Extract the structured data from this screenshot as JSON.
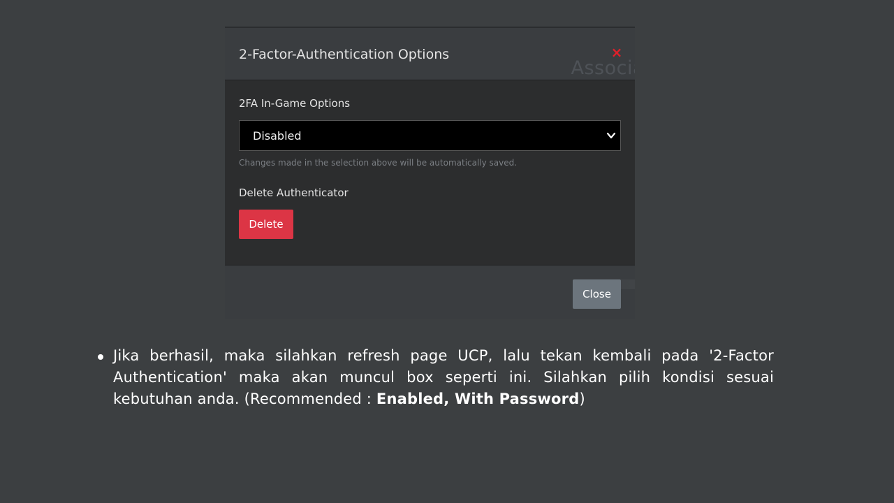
{
  "modal": {
    "title": "2-Factor-Authentication Options",
    "background_ghost_text": "Associa",
    "close_icon_glyph": "×",
    "close_icon_color": "#e0202a",
    "ingame_label": "2FA In-Game Options",
    "select": {
      "selected_value": "Disabled"
    },
    "help_text": "Changes made in the selection above will be automatically saved.",
    "delete_label": "Delete Authenticator",
    "delete_button": "Delete",
    "delete_button_color": "#dc3545",
    "close_button": "Close",
    "close_button_color": "#6c757d"
  },
  "instruction": {
    "text_before": "Jika berhasil, maka silahkan refresh page UCP, lalu tekan kembali pada '2-Factor Authentication' maka akan muncul box seperti ini. Silahkan pilih kondisi sesuai kebutuhan anda.  (Recommended : ",
    "bold_text": "Enabled, With Password",
    "text_after": ")"
  }
}
